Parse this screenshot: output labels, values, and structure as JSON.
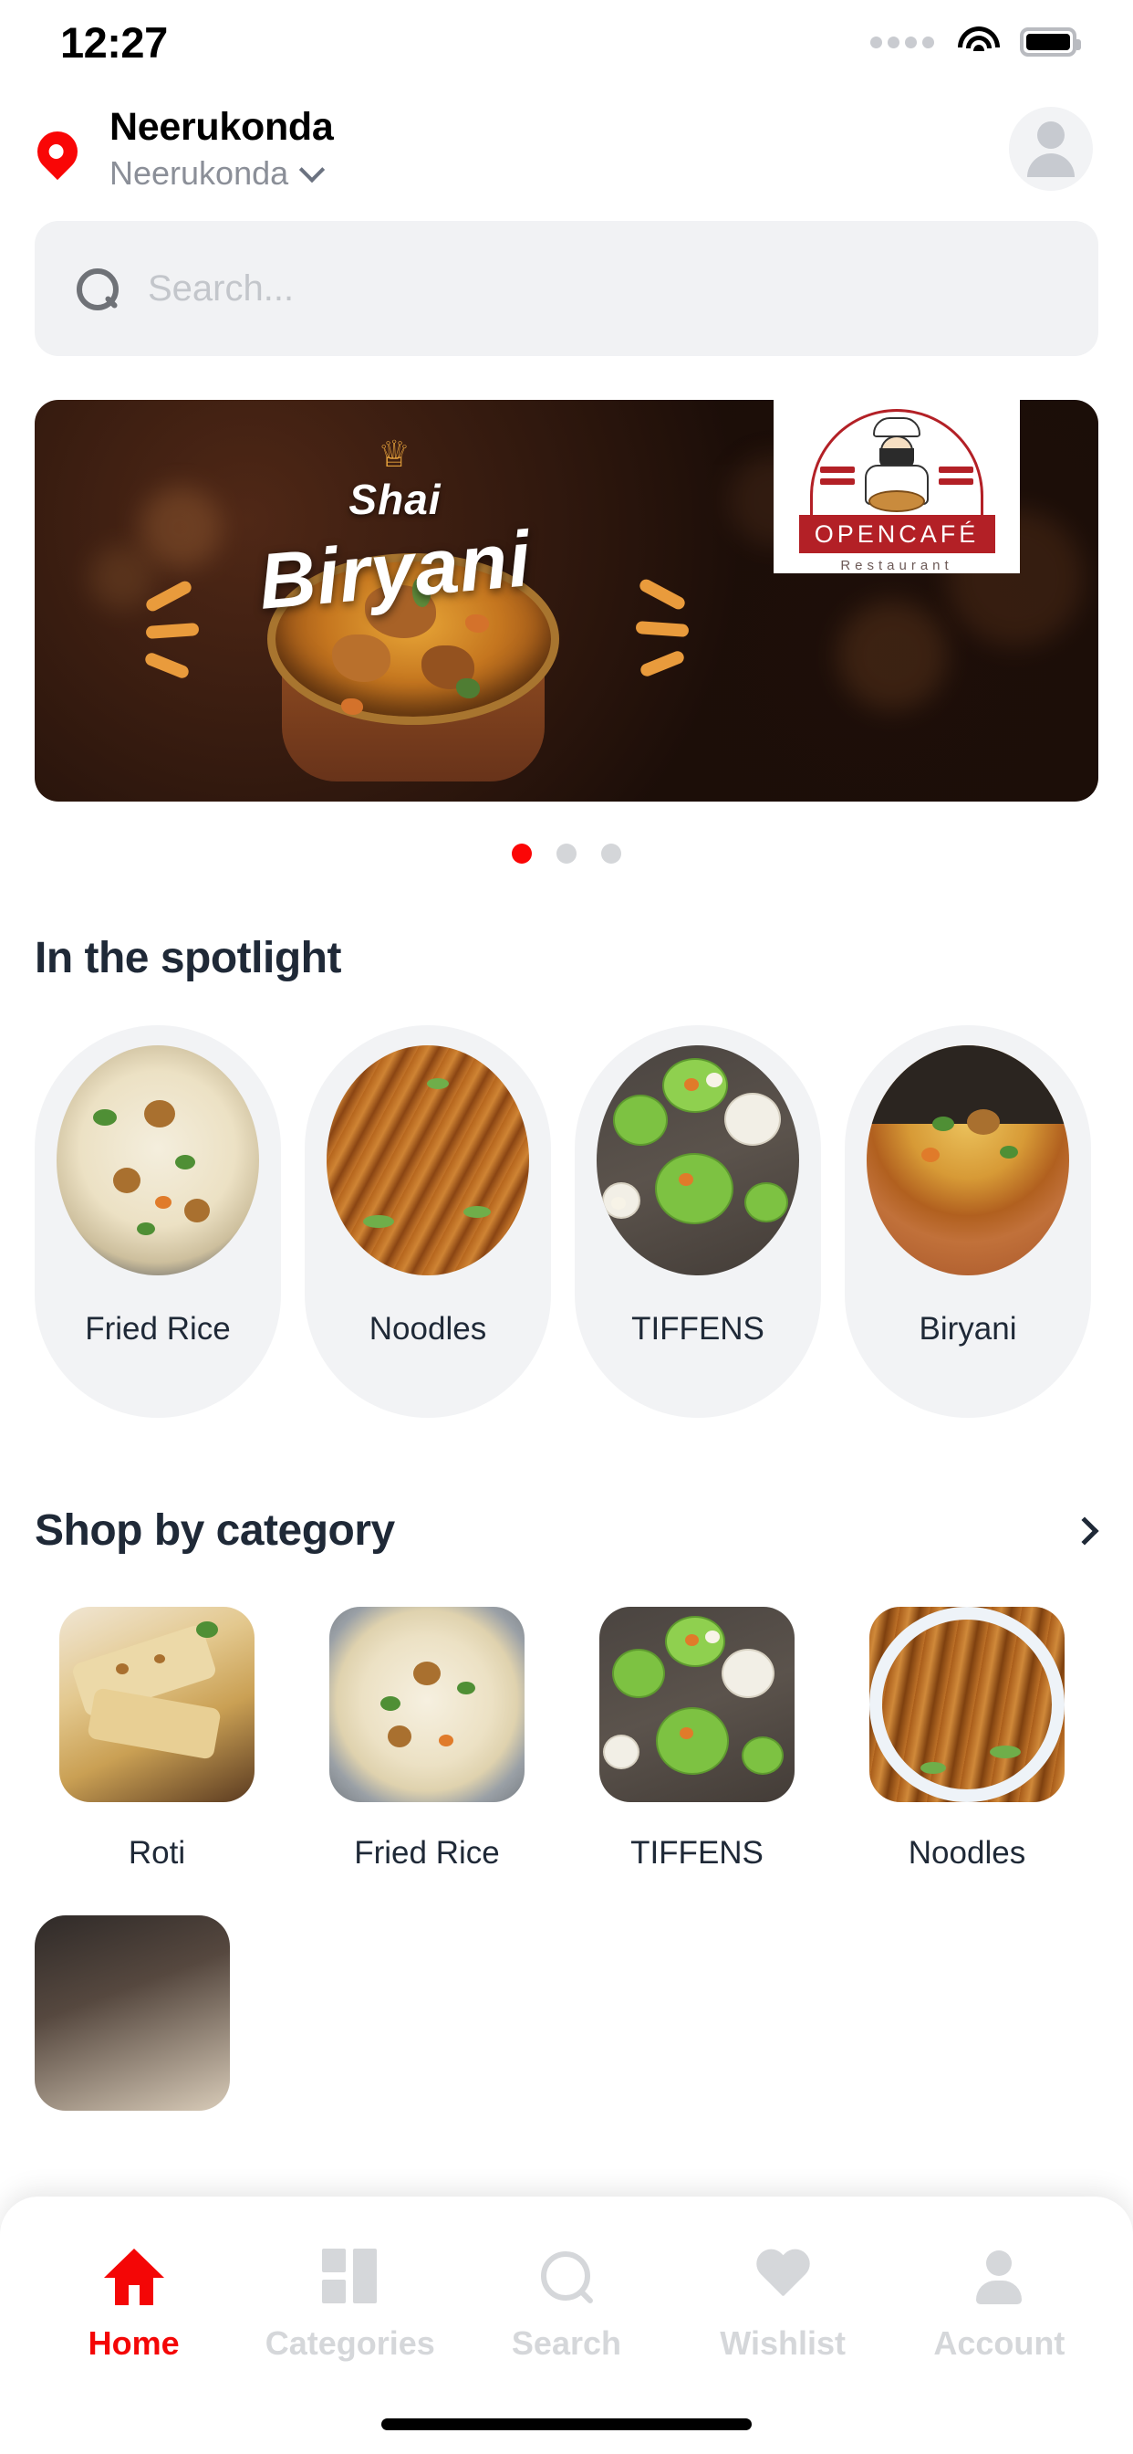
{
  "status_bar": {
    "time": "12:27",
    "signal_icon": "signal-dots-icon",
    "wifi_icon": "wifi-icon",
    "battery_icon": "battery-full-icon"
  },
  "header": {
    "location_icon": "location-pin-icon",
    "location_title": "Neerukonda",
    "location_subtitle": "Neerukonda",
    "dropdown_icon": "chevron-down-icon",
    "avatar_icon": "account-avatar-icon"
  },
  "search": {
    "icon": "search-icon",
    "placeholder": "Search...",
    "value": ""
  },
  "banner": {
    "crown_icon": "crown-icon",
    "title_line1": "Shai",
    "title_line2": "Biryani",
    "logo": {
      "brand": "OPENCAFÉ",
      "tagline": "Restaurant",
      "chef_icon": "chef-logo-icon"
    },
    "dots": [
      {
        "active": true
      },
      {
        "active": false
      },
      {
        "active": false
      }
    ]
  },
  "spotlight": {
    "title": "In the spotlight",
    "items": [
      {
        "label": "Fried Rice",
        "image": "fried-rice-bowl"
      },
      {
        "label": "Noodles",
        "image": "noodles-plate"
      },
      {
        "label": "TIFFENS",
        "image": "tiffens-thali"
      },
      {
        "label": "Biryani",
        "image": "biryani-clay-pot"
      }
    ]
  },
  "shop_by_category": {
    "title": "Shop by category",
    "see_all_icon": "chevron-right-icon",
    "items": [
      {
        "label": "Roti",
        "image": "roti-basket"
      },
      {
        "label": "Fried Rice",
        "image": "fried-rice-bowl"
      },
      {
        "label": "TIFFENS",
        "image": "tiffens-thali"
      },
      {
        "label": "Noodles",
        "image": "noodles-plate"
      }
    ],
    "next_row_peek": [
      {
        "image": "partial-food-tile"
      }
    ]
  },
  "bottom_nav": {
    "active_color": "#f40606",
    "inactive_color": "#d5d7da",
    "items": [
      {
        "label": "Home",
        "icon": "home-icon",
        "active": true
      },
      {
        "label": "Categories",
        "icon": "grid-icon",
        "active": false
      },
      {
        "label": "Search",
        "icon": "search-icon",
        "active": false
      },
      {
        "label": "Wishlist",
        "icon": "heart-icon",
        "active": false
      },
      {
        "label": "Account",
        "icon": "user-icon",
        "active": false
      }
    ]
  }
}
